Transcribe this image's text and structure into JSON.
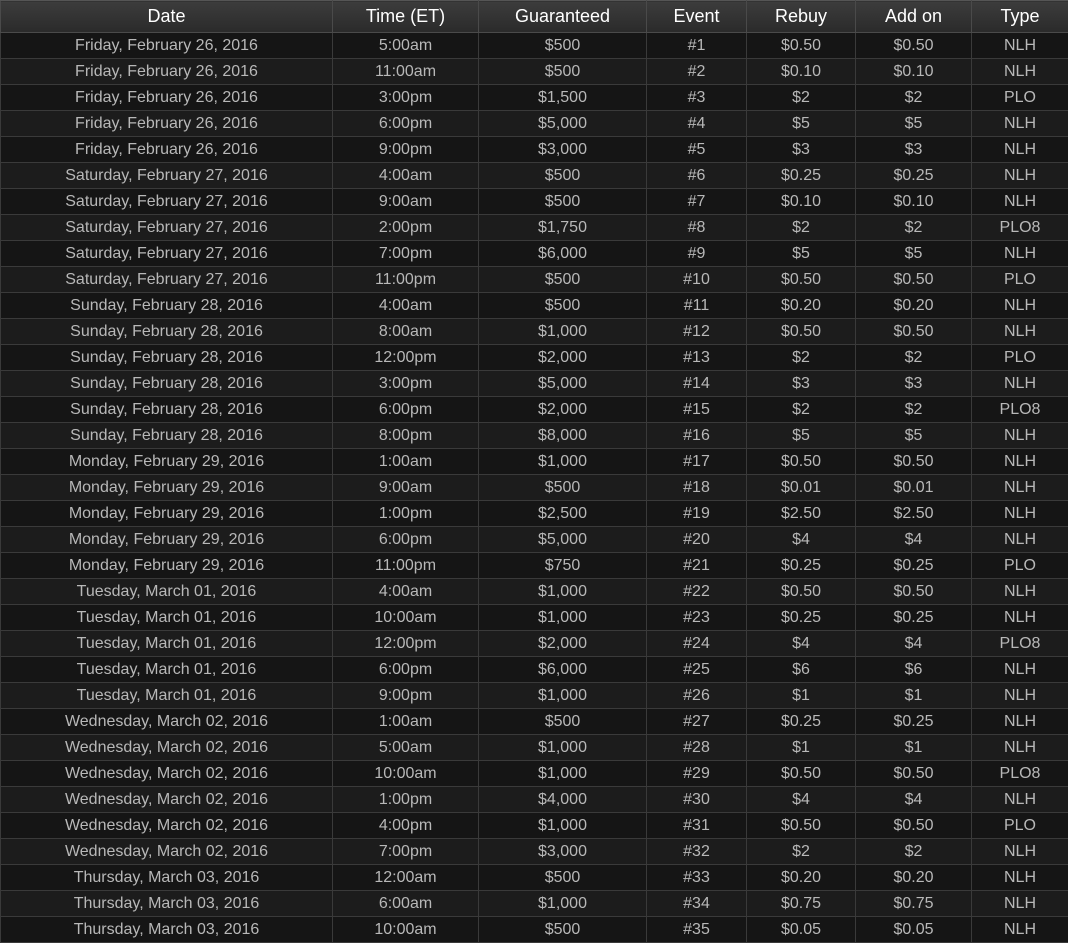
{
  "table": {
    "headers": [
      "Date",
      "Time (ET)",
      "Guaranteed",
      "Event",
      "Rebuy",
      "Add on",
      "Type"
    ],
    "rows": [
      [
        "Friday, February 26, 2016",
        "5:00am",
        "$500",
        "#1",
        "$0.50",
        "$0.50",
        "NLH"
      ],
      [
        "Friday, February 26, 2016",
        "11:00am",
        "$500",
        "#2",
        "$0.10",
        "$0.10",
        "NLH"
      ],
      [
        "Friday, February 26, 2016",
        "3:00pm",
        "$1,500",
        "#3",
        "$2",
        "$2",
        "PLO"
      ],
      [
        "Friday, February 26, 2016",
        "6:00pm",
        "$5,000",
        "#4",
        "$5",
        "$5",
        "NLH"
      ],
      [
        "Friday, February 26, 2016",
        "9:00pm",
        "$3,000",
        "#5",
        "$3",
        "$3",
        "NLH"
      ],
      [
        "Saturday, February 27, 2016",
        "4:00am",
        "$500",
        "#6",
        "$0.25",
        "$0.25",
        "NLH"
      ],
      [
        "Saturday, February 27, 2016",
        "9:00am",
        "$500",
        "#7",
        "$0.10",
        "$0.10",
        "NLH"
      ],
      [
        "Saturday, February 27, 2016",
        "2:00pm",
        "$1,750",
        "#8",
        "$2",
        "$2",
        "PLO8"
      ],
      [
        "Saturday, February 27, 2016",
        "7:00pm",
        "$6,000",
        "#9",
        "$5",
        "$5",
        "NLH"
      ],
      [
        "Saturday, February 27, 2016",
        "11:00pm",
        "$500",
        "#10",
        "$0.50",
        "$0.50",
        "PLO"
      ],
      [
        "Sunday, February 28, 2016",
        "4:00am",
        "$500",
        "#11",
        "$0.20",
        "$0.20",
        "NLH"
      ],
      [
        "Sunday, February 28, 2016",
        "8:00am",
        "$1,000",
        "#12",
        "$0.50",
        "$0.50",
        "NLH"
      ],
      [
        "Sunday, February 28, 2016",
        "12:00pm",
        "$2,000",
        "#13",
        "$2",
        "$2",
        "PLO"
      ],
      [
        "Sunday, February 28, 2016",
        "3:00pm",
        "$5,000",
        "#14",
        "$3",
        "$3",
        "NLH"
      ],
      [
        "Sunday, February 28, 2016",
        "6:00pm",
        "$2,000",
        "#15",
        "$2",
        "$2",
        "PLO8"
      ],
      [
        "Sunday, February 28, 2016",
        "8:00pm",
        "$8,000",
        "#16",
        "$5",
        "$5",
        "NLH"
      ],
      [
        "Monday, February 29, 2016",
        "1:00am",
        "$1,000",
        "#17",
        "$0.50",
        "$0.50",
        "NLH"
      ],
      [
        "Monday, February 29, 2016",
        "9:00am",
        "$500",
        "#18",
        "$0.01",
        "$0.01",
        "NLH"
      ],
      [
        "Monday, February 29, 2016",
        "1:00pm",
        "$2,500",
        "#19",
        "$2.50",
        "$2.50",
        "NLH"
      ],
      [
        "Monday, February 29, 2016",
        "6:00pm",
        "$5,000",
        "#20",
        "$4",
        "$4",
        "NLH"
      ],
      [
        "Monday, February 29, 2016",
        "11:00pm",
        "$750",
        "#21",
        "$0.25",
        "$0.25",
        "PLO"
      ],
      [
        "Tuesday, March 01, 2016",
        "4:00am",
        "$1,000",
        "#22",
        "$0.50",
        "$0.50",
        "NLH"
      ],
      [
        "Tuesday, March 01, 2016",
        "10:00am",
        "$1,000",
        "#23",
        "$0.25",
        "$0.25",
        "NLH"
      ],
      [
        "Tuesday, March 01, 2016",
        "12:00pm",
        "$2,000",
        "#24",
        "$4",
        "$4",
        "PLO8"
      ],
      [
        "Tuesday, March 01, 2016",
        "6:00pm",
        "$6,000",
        "#25",
        "$6",
        "$6",
        "NLH"
      ],
      [
        "Tuesday, March 01, 2016",
        "9:00pm",
        "$1,000",
        "#26",
        "$1",
        "$1",
        "NLH"
      ],
      [
        "Wednesday, March 02, 2016",
        "1:00am",
        "$500",
        "#27",
        "$0.25",
        "$0.25",
        "NLH"
      ],
      [
        "Wednesday, March 02, 2016",
        "5:00am",
        "$1,000",
        "#28",
        "$1",
        "$1",
        "NLH"
      ],
      [
        "Wednesday, March 02, 2016",
        "10:00am",
        "$1,000",
        "#29",
        "$0.50",
        "$0.50",
        "PLO8"
      ],
      [
        "Wednesday, March 02, 2016",
        "1:00pm",
        "$4,000",
        "#30",
        "$4",
        "$4",
        "NLH"
      ],
      [
        "Wednesday, March 02, 2016",
        "4:00pm",
        "$1,000",
        "#31",
        "$0.50",
        "$0.50",
        "PLO"
      ],
      [
        "Wednesday, March 02, 2016",
        "7:00pm",
        "$3,000",
        "#32",
        "$2",
        "$2",
        "NLH"
      ],
      [
        "Thursday, March 03, 2016",
        "12:00am",
        "$500",
        "#33",
        "$0.20",
        "$0.20",
        "NLH"
      ],
      [
        "Thursday, March 03, 2016",
        "6:00am",
        "$1,000",
        "#34",
        "$0.75",
        "$0.75",
        "NLH"
      ],
      [
        "Thursday, March 03, 2016",
        "10:00am",
        "$500",
        "#35",
        "$0.05",
        "$0.05",
        "NLH"
      ]
    ]
  }
}
